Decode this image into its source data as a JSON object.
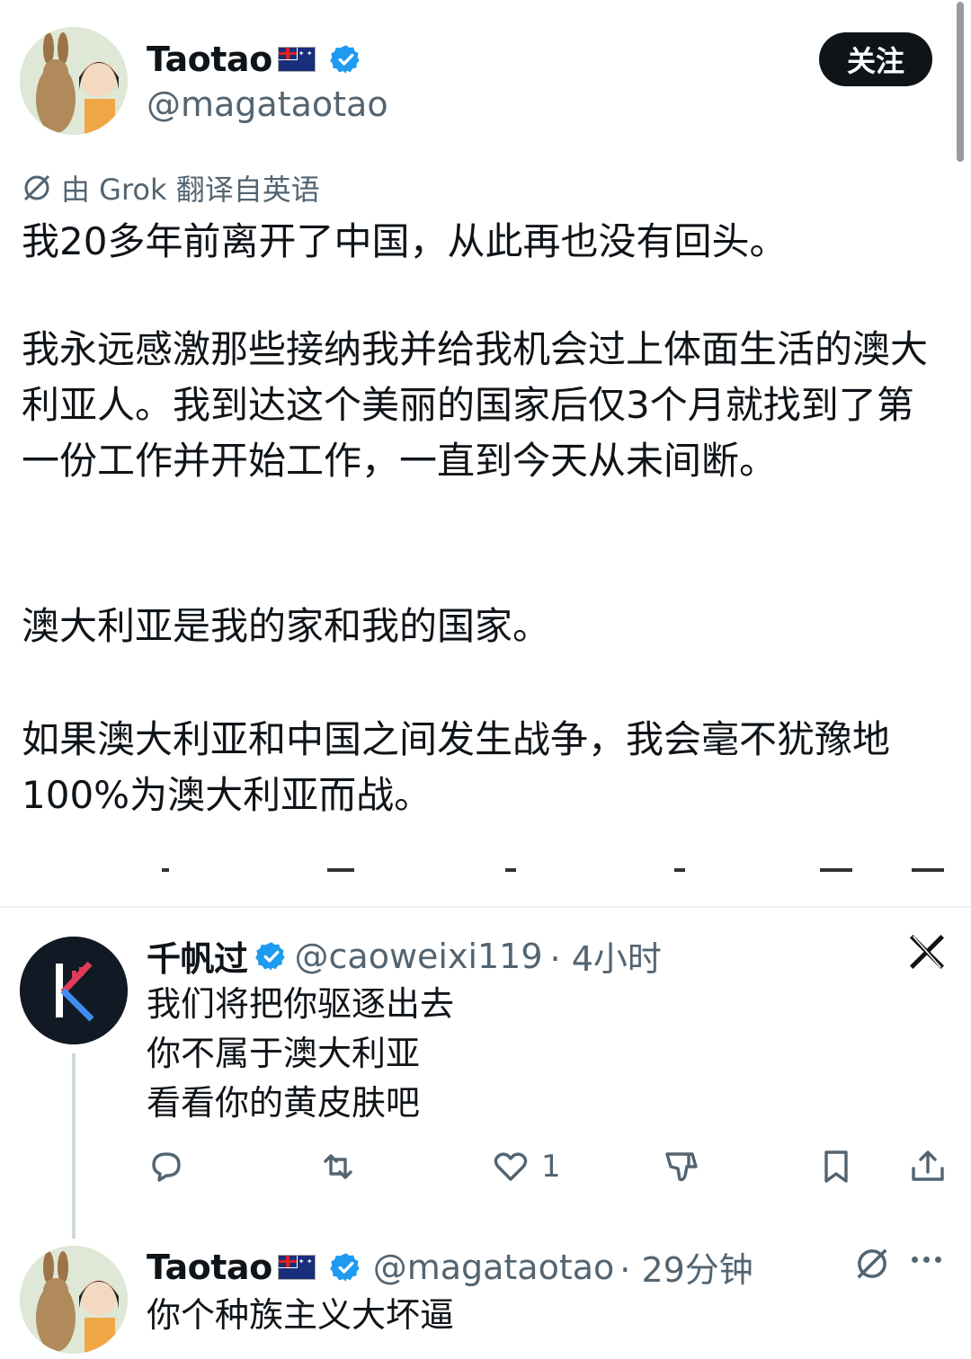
{
  "tweet": {
    "author_name": "Taotao",
    "author_handle": "@magataotao",
    "follow_label": "关注",
    "translation_note": "由 Grok 翻译自英语",
    "paragraphs": [
      "我20多年前离开了中国，从此再也没有回头。",
      "我永远感激那些接纳我并给我机会过上体面生活的澳大利亚人。我到达这个美丽的国家后仅3个月就找到了第一份工作并开始工作，一直到今天从未间断。",
      "澳大利亚是我的家和我的国家。",
      "如果澳大利亚和中国之间发生战争，我会毫不犹豫地100%为澳大利亚而战。"
    ]
  },
  "reply1": {
    "author_name": "千帆过",
    "author_handle": "@caoweixi119",
    "time": "· 4小时",
    "lines": [
      "我们将把你驱逐出去",
      "你不属于澳大利亚",
      "看看你的黄皮肤吧"
    ],
    "like_count": "1"
  },
  "reply2": {
    "author_name": "Taotao",
    "author_handle": "@magataotao",
    "time": "· 29分钟",
    "text": "你个种族主义大坏逼"
  },
  "colors": {
    "accent": "#1d9bf0",
    "text": "#0f1419",
    "muted": "#536471"
  }
}
